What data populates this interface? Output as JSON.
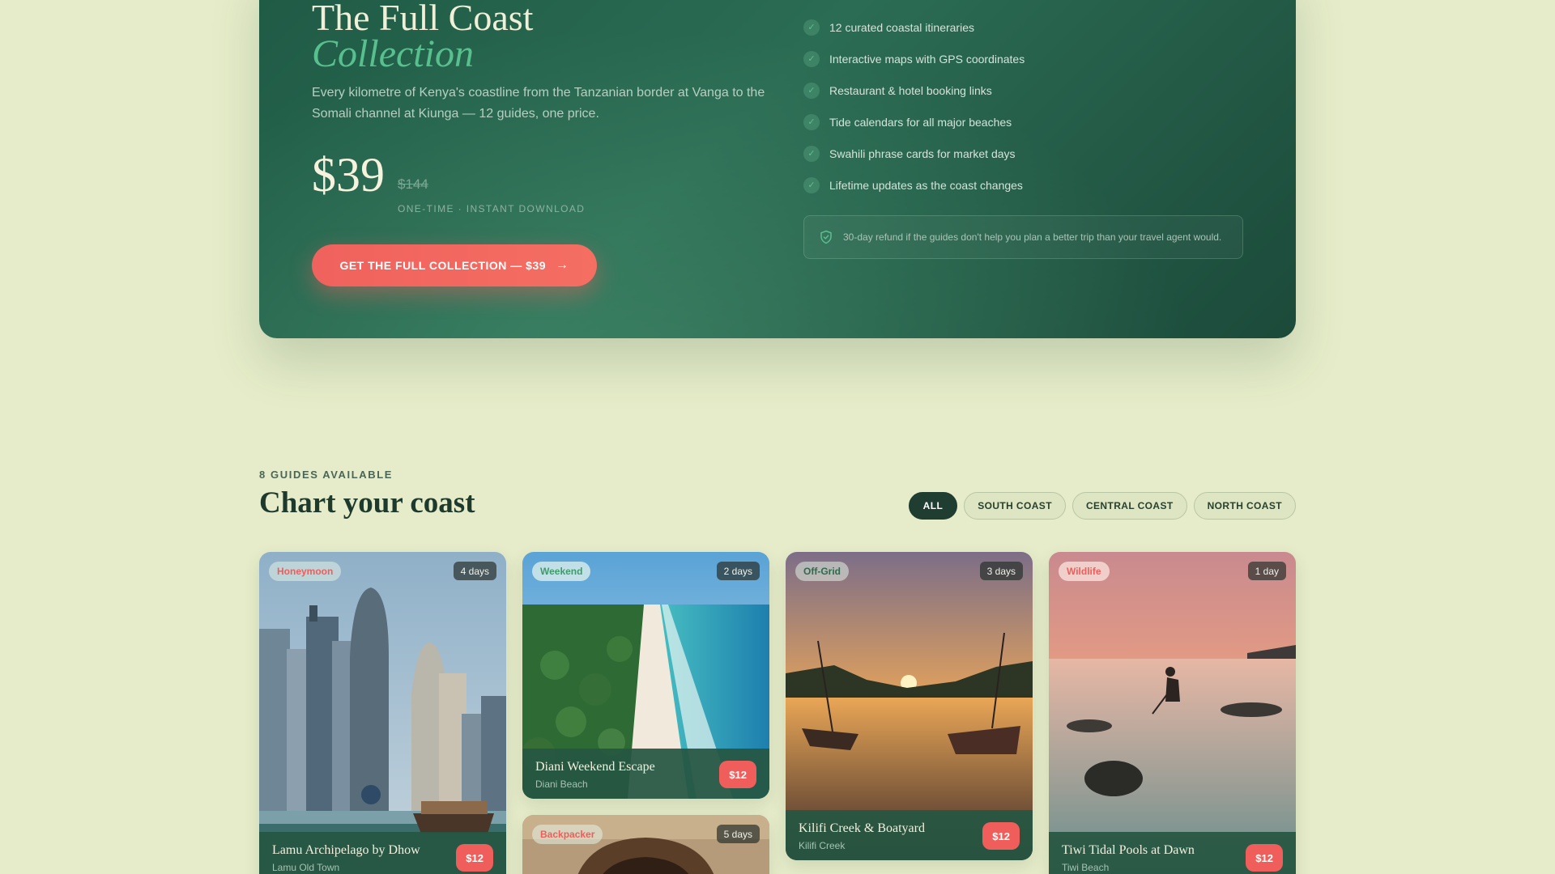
{
  "hero": {
    "title": "The Full Coast",
    "title_accent": "Collection",
    "description": "Every kilometre of Kenya's coastline from the Tanzanian border at Vanga to the Somali channel at Kiunga — 12 guides, one price.",
    "price": "$39",
    "old_price": "$144",
    "price_note": "ONE-TIME · INSTANT DOWNLOAD",
    "cta_label": "GET THE FULL COLLECTION — $39",
    "features": [
      "12 curated coastal itineraries",
      "Interactive maps with GPS coordinates",
      "Restaurant & hotel booking links",
      "Tide calendars for all major beaches",
      "Swahili phrase cards for market days",
      "Lifetime updates as the coast changes"
    ],
    "refund_note": "30-day refund if the guides don't help you plan a better trip than your travel agent would."
  },
  "guides": {
    "eyebrow": "8 GUIDES AVAILABLE",
    "title": "Chart your coast",
    "filters": [
      "ALL",
      "SOUTH COAST",
      "CENTRAL COAST",
      "NORTH COAST"
    ],
    "active_filter": "ALL",
    "cards": [
      {
        "tag": "Honeymoon",
        "days": "4 days",
        "name": "Lamu Archipelago by Dhow",
        "location": "Lamu Old Town",
        "price": "$12"
      },
      {
        "tag": "Weekend",
        "days": "2 days",
        "name": "Diani Weekend Escape",
        "location": "Diani Beach",
        "price": "$12"
      },
      {
        "tag": "Off-Grid",
        "days": "3 days",
        "name": "Kilifi Creek & Boatyard",
        "location": "Kilifi Creek",
        "price": "$12"
      },
      {
        "tag": "Wildlife",
        "days": "1 day",
        "name": "Tiwi Tidal Pools at Dawn",
        "location": "Tiwi Beach",
        "price": "$12"
      },
      {
        "tag": "Backpacker",
        "days": "5 days"
      }
    ]
  },
  "colors": {
    "background": "#e6ecc9",
    "hero_green": "#2b6c54",
    "accent_green": "#58c08e",
    "coral": "#ef5e5a"
  },
  "icons": {
    "feature": "check-icon",
    "refund": "shield-check-icon",
    "cta": "arrow-right-icon"
  }
}
